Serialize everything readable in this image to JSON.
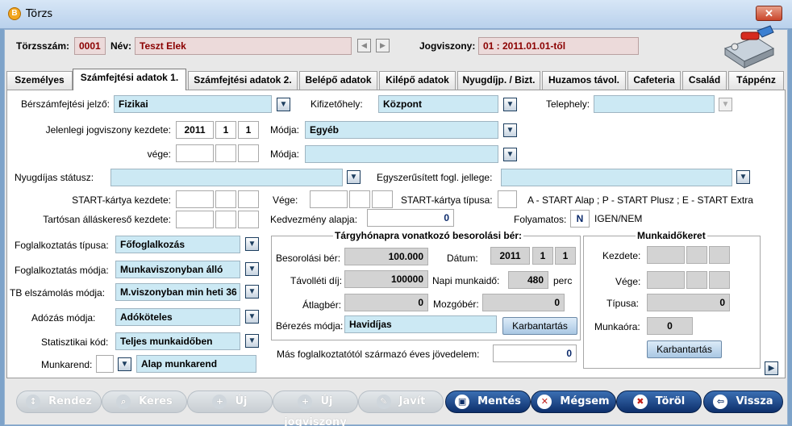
{
  "window": {
    "title": "Törzs",
    "close": "✕",
    "app_icon": "B"
  },
  "header": {
    "torzsszam_label": "Törzsszám:",
    "torzsszam": "0001",
    "nev_label": "Név:",
    "nev": "Teszt Elek",
    "jogviszony_label": "Jogviszony:",
    "jogviszony": "01 : 2011.01.01-től"
  },
  "tabs": [
    "Személyes",
    "Számfejtési adatok 1.",
    "Számfejtési adatok 2.",
    "Belépő adatok",
    "Kilépő adatok",
    "Nyugdíjp. / Bizt.",
    "Huzamos távol.",
    "Cafeteria",
    "Család",
    "Táppénz"
  ],
  "form": {
    "berszam_label": "Bérszámfejtési jelző:",
    "berszam": "Fizikai",
    "kifizeto_label": "Kifizetőhely:",
    "kifizeto": "Központ",
    "telephely_label": "Telephely:",
    "telephely": "",
    "jkezd_label": "Jelenlegi jogviszony kezdete:",
    "jkezd_y": "2011",
    "jkezd_m": "1",
    "jkezd_d": "1",
    "modja_label": "Módja:",
    "modja": "Egyéb",
    "vege_label": "vége:",
    "modja2_label": "Módja:",
    "modja2": "",
    "nyugdij_label": "Nyugdíjas státusz:",
    "nyugdij": "",
    "egysz_label": "Egyszerűsített fogl. jellege:",
    "egysz": "",
    "start_kezd_label": "START-kártya kezdete:",
    "start_vege_label": "Vége:",
    "start_tipus_label": "START-kártya típusa:",
    "start_tipus": "",
    "start_legend": "A - START Alap ; P - START Plusz ; E - START Extra",
    "tartos_label": "Tartósan álláskereső kezdete:",
    "kedv_label": "Kedvezmény alapja:",
    "kedv": "0",
    "folyamatos_label": "Folyamatos:",
    "folyamatos": "N",
    "igen_nem": "IGEN/NEM",
    "fogl_tipus_label": "Foglalkoztatás típusa:",
    "fogl_tipus": "Főfoglalkozás",
    "fogl_mod_label": "Foglalkoztatás módja:",
    "fogl_mod": "Munkaviszonyban álló",
    "tb_label": "TB elszámolás módja:",
    "tb": "M.viszonyban min heti 36",
    "adozas_label": "Adózás módja:",
    "adozas": "Adóköteles",
    "stat_label": "Statisztikai kód:",
    "stat": "Teljes munkaidőben",
    "munkarend_label": "Munkarend:",
    "munkarend_code": "",
    "munkarend": "Alap munkarend",
    "mas_label": "Más foglalkoztatótól származó éves jövedelem:",
    "mas": "0"
  },
  "berek": {
    "title": "Tárgyhónapra vonatkozó besorolási bér:",
    "besorolasi_label": "Besorolási bér:",
    "besorolasi": "100.000",
    "datum_label": "Dátum:",
    "datum_y": "2011",
    "datum_m": "1",
    "datum_d": "1",
    "tavolleti_label": "Távolléti díj:",
    "tavolleti": "100000",
    "napi_label": "Napi munkaidő:",
    "napi": "480",
    "perc": "perc",
    "atlagber_label": "Átlagbér:",
    "atlagber": "0",
    "mozgober_label": "Mozgóbér:",
    "mozgober": "0",
    "berezes_label": "Bérezés módja:",
    "berezes": "Havidíjas",
    "karbantartas": "Karbantartás"
  },
  "munkaido": {
    "title": "Munkaidőkeret",
    "kezdete_label": "Kezdete:",
    "vege_label": "Vége:",
    "tipusa_label": "Típusa:",
    "tipusa": "0",
    "munkaora_label": "Munkaóra:",
    "munkaora": "0",
    "karbantartas": "Karbantartás"
  },
  "buttons": {
    "rendez": "Rendez",
    "keres": "Keres",
    "uj": "Új",
    "uj_jogviszony": "Új jogviszony",
    "javit": "Javít",
    "mentes": "Mentés",
    "megsem": "Mégsem",
    "torol": "Töröl",
    "vissza": "Vissza"
  }
}
